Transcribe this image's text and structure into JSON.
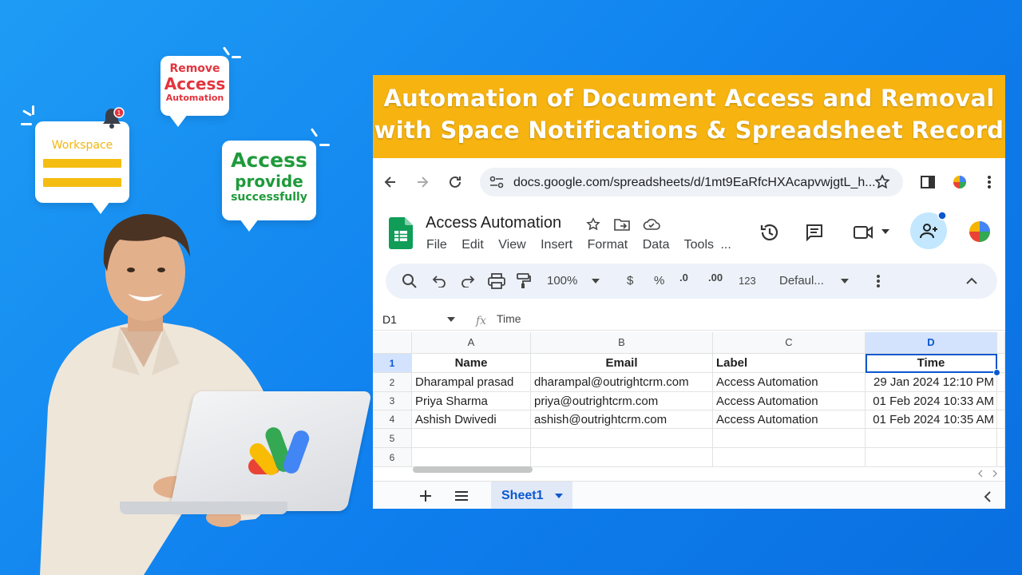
{
  "bubbles": {
    "remove": {
      "line1": "Remove",
      "line2": "Access",
      "line3": "Automation"
    },
    "workspace": {
      "label": "Workspace",
      "badge": "1"
    },
    "access": {
      "line1": "Access",
      "line2": "provide",
      "line3": "successfully"
    }
  },
  "banner": {
    "line1": "Automation of Document Access and Removal",
    "line2": "with Space Notifications & Spreadsheet Record"
  },
  "browser": {
    "url": "docs.google.com/spreadsheets/d/1mt9EaRfcHXAcapvwjgtL_h..."
  },
  "sheets": {
    "title": "Access Automation",
    "menu": [
      "File",
      "Edit",
      "View",
      "Insert",
      "Format",
      "Data",
      "Tools",
      "..."
    ],
    "toolbar": {
      "zoom": "100%",
      "currency": "$",
      "percent": "%",
      "dec_decrease": ".0",
      "dec_increase": ".00",
      "number_format": "123",
      "font": "Defaul..."
    },
    "name_box": "D1",
    "formula_value": "Time",
    "columns": [
      "A",
      "B",
      "C",
      "D"
    ],
    "rows": [
      "1",
      "2",
      "3",
      "4",
      "5",
      "6"
    ],
    "header": [
      "Name",
      "Email",
      "Label",
      "Time"
    ],
    "data": [
      [
        "Dharampal prasad",
        "dharampal@outrightcrm.com",
        "Access Automation",
        "29 Jan 2024 12:10 PM"
      ],
      [
        "Priya Sharma",
        "priya@outrightcrm.com",
        "Access Automation",
        "01 Feb 2024 10:33 AM"
      ],
      [
        "Ashish Dwivedi",
        "ashish@outrightcrm.com",
        "Access Automation",
        "01 Feb 2024 10:35 AM"
      ]
    ],
    "sheet_tab": "Sheet1"
  },
  "colors": {
    "background": "#1289f0",
    "banner": "#f7b411",
    "remove_text": "#e3343d",
    "access_text": "#1f9a3b",
    "workspace_accent": "#f5bd12",
    "selection": "#0b57d0"
  }
}
